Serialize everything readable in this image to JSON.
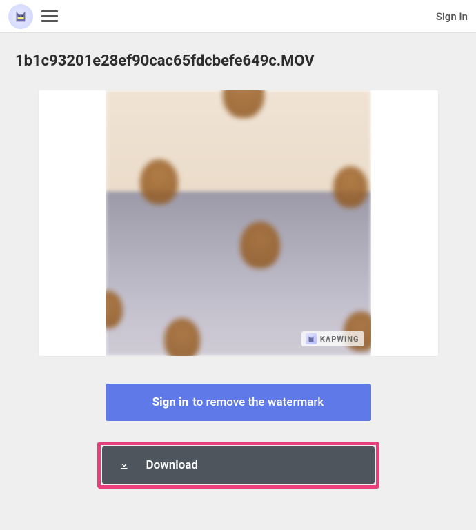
{
  "header": {
    "signin": "Sign In"
  },
  "page": {
    "title": "1b1c93201e28ef90cac65fdcbefe649c.MOV"
  },
  "watermark": {
    "brand": "KAPWING"
  },
  "buttons": {
    "signin_bold": "Sign in",
    "signin_rest": " to remove the watermark",
    "download": "Download"
  }
}
